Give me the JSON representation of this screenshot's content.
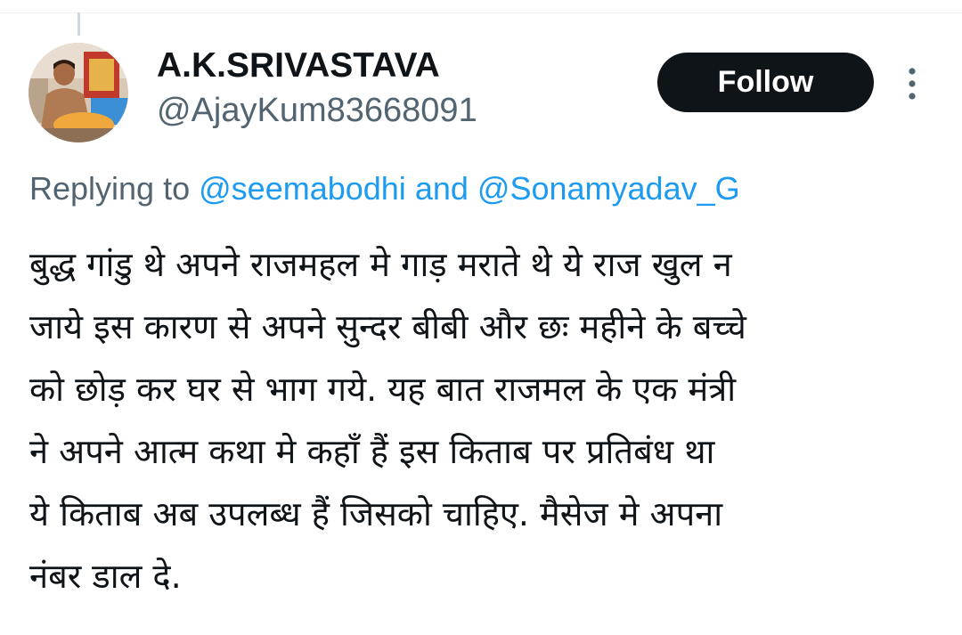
{
  "tweet": {
    "author": {
      "display_name": "A.K.SRIVASTAVA",
      "handle": "@AjayKum83668091"
    },
    "follow_label": "Follow",
    "more_icon": "more-vertical-icon",
    "reply": {
      "prefix": "Replying to",
      "mention_1": "@seemabodhi",
      "conjunction": "and",
      "mention_2": "@Sonamyadav_G"
    },
    "text_lines": [
      "बुद्ध गांडु थे अपने राजमहल मे गाड़ मराते थे ये राज खुल न",
      "जाये इस कारण से अपने सुन्दर बीबी और छः महीने के बच्चे",
      "को छोड़ कर घर से भाग गये. यह बात राजमल के एक मंत्री",
      "ने अपने आत्म कथा मे कहाँ हैं इस किताब पर प्रतिबंध था",
      "ये किताब अब उपलब्ध हैं जिसको चाहिए. मैसेज मे अपना",
      "नंबर डाल दे."
    ]
  },
  "colors": {
    "text_primary": "#0f1419",
    "text_secondary": "#536471",
    "link": "#1d9bf0",
    "button_bg": "#0f1419",
    "button_text": "#ffffff"
  }
}
